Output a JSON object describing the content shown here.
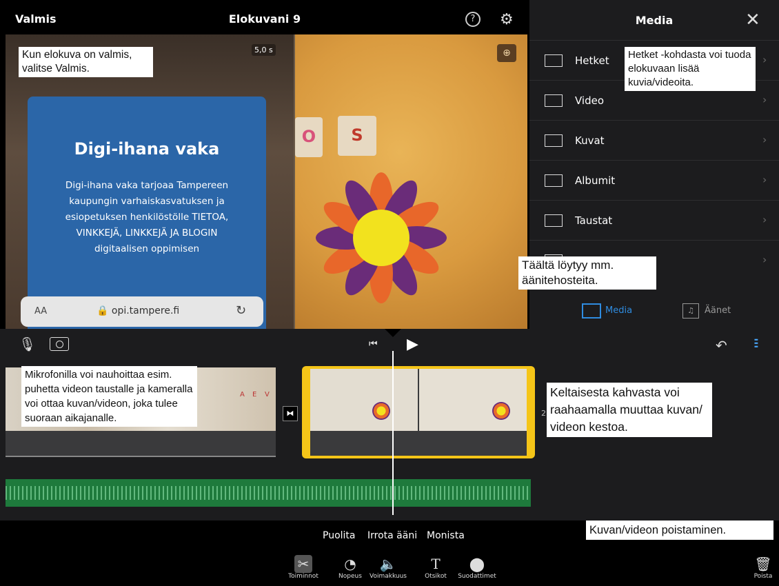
{
  "topbar": {
    "done_label": "Valmis",
    "title": "Elokuvani 9",
    "help_icon": "question-circle-icon",
    "settings_icon": "gear-icon"
  },
  "preview": {
    "duration_badge": "5,0 s",
    "phone_screen": {
      "heading": "Digi-ihana vaka",
      "body": "Digi-ihana vaka tarjoaa Tampereen kaupungin varhaiskasvatuksen ja esiopetuksen henkilöstölle TIETOA, VINKKEJÄ, LINKKEJÄ JA BLOGIN digitaalisen oppimisen",
      "text_size_button": "AA",
      "url": "opi.tampere.fi"
    },
    "tile_letters": [
      "O",
      "S"
    ]
  },
  "media_panel": {
    "title": "Media",
    "close_icon": "close-icon",
    "items": [
      {
        "label": "Hetket",
        "icon": "moments-icon"
      },
      {
        "label": "Video",
        "icon": "film-icon"
      },
      {
        "label": "Kuvat",
        "icon": "photo-icon"
      },
      {
        "label": "Albumit",
        "icon": "album-icon"
      },
      {
        "label": "Taustat",
        "icon": "backgrounds-icon"
      },
      {
        "label": "",
        "icon": "folder-icon"
      }
    ],
    "tabs": [
      {
        "label": "Media",
        "active": true
      },
      {
        "label": "Äänet",
        "active": false
      }
    ],
    "accent_color": "#2f8ce0"
  },
  "timeline": {
    "clip_duration_small": "2",
    "audio_color": "#1e7a3c",
    "handle_color": "#f5c518",
    "clip1_letters": [
      "A",
      "E",
      "V"
    ]
  },
  "actions": {
    "split": "Puolita",
    "detach_audio": "Irrota ääni",
    "duplicate": "Monista"
  },
  "tools": {
    "actions": "Toiminnot",
    "speed": "Nopeus",
    "volume": "Voimakkuus",
    "titles": "Otsikot",
    "filters": "Suodattimet",
    "delete": "Poista"
  },
  "annotations": {
    "valmis": "Kun elokuva on valmis, valitse Valmis.",
    "hetket": "Hetket -kohdasta voi tuoda elokuvaan lisää kuvia/videoita.",
    "sounds": "Täältä löytyy mm. äänitehosteita.",
    "mic": "Mikrofonilla voi nauhoittaa esim. puhetta videon taustalle ja kameralla voi ottaa kuvan/videon, joka tulee suoraan aikajanalle.",
    "handle": "Keltaisesta kahvasta voi raahaamalla muuttaa kuvan/ videon kestoa.",
    "delete": "Kuvan/videon poistaminen."
  }
}
